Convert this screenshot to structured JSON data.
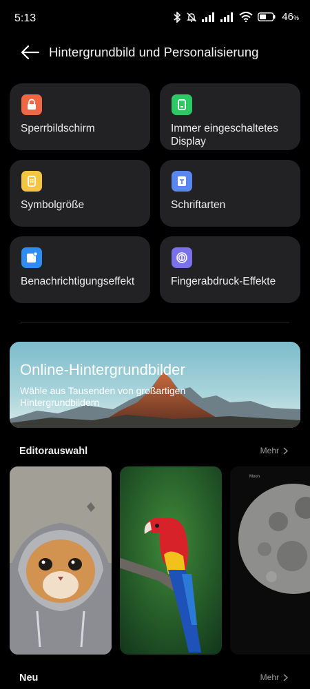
{
  "status": {
    "time": "5:13",
    "battery": "46",
    "battery_suffix": "%"
  },
  "header": {
    "title": "Hintergrundbild und Personalisierung"
  },
  "tiles": [
    {
      "label": "Sperrbildschirm",
      "icon": "lock-icon",
      "color": "#ef6845"
    },
    {
      "label": "Immer eingeschaltetes Display",
      "icon": "display-icon",
      "color": "#2dc765"
    },
    {
      "label": "Symbolgröße",
      "icon": "app-icon",
      "color": "#f4c542"
    },
    {
      "label": "Schriftarten",
      "icon": "font-icon",
      "color": "#5a86f0"
    },
    {
      "label": "Benachrichtigungseffekt",
      "icon": "notification-icon",
      "color": "#2e8df5"
    },
    {
      "label": "Fingerabdruck-Effekte",
      "icon": "fingerprint-icon",
      "color": "#7a70ea"
    }
  ],
  "banner": {
    "title": "Online-Hintergrundbilder",
    "subtitle": "Wähle aus Tausenden von großartigen Hintergrundbildern"
  },
  "editors_choice": {
    "title": "Editorauswahl",
    "more": "Mehr",
    "cards": [
      {
        "name": "cat-wallpaper"
      },
      {
        "name": "parrot-wallpaper"
      },
      {
        "name": "moon-wallpaper",
        "label": "Moon"
      }
    ]
  },
  "new_section": {
    "title": "Neu",
    "more": "Mehr"
  }
}
